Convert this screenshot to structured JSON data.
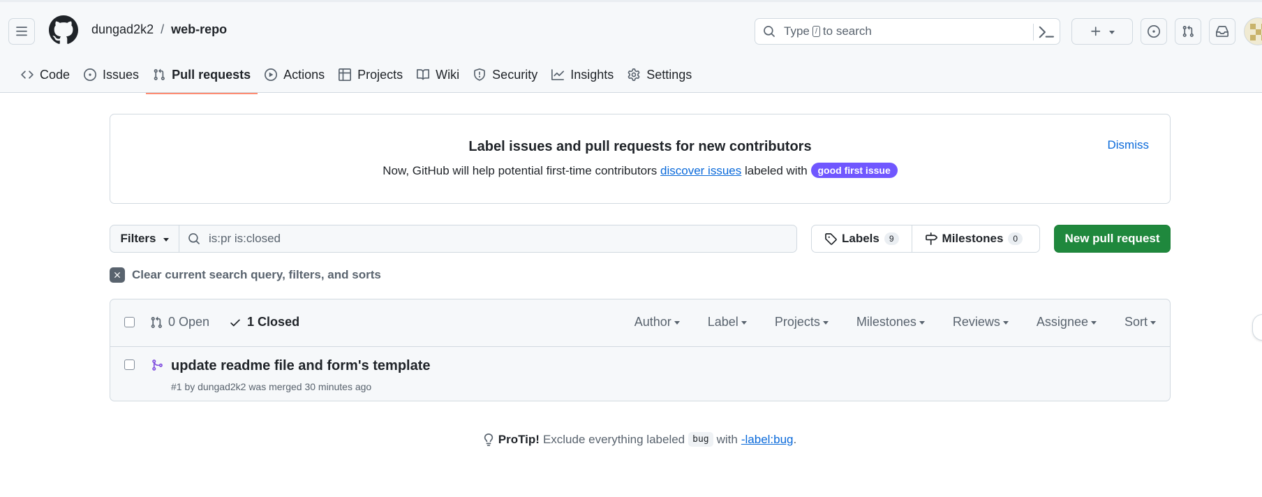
{
  "header": {
    "owner": "dungad2k2",
    "separator": "/",
    "repo": "web-repo",
    "search_prefix": "Type",
    "search_key": "/",
    "search_suffix": "to search"
  },
  "tabs": [
    {
      "label": "Code",
      "icon": "code-icon"
    },
    {
      "label": "Issues",
      "icon": "issue-icon"
    },
    {
      "label": "Pull requests",
      "icon": "pull-request-icon",
      "active": true
    },
    {
      "label": "Actions",
      "icon": "play-icon"
    },
    {
      "label": "Projects",
      "icon": "table-icon"
    },
    {
      "label": "Wiki",
      "icon": "book-icon"
    },
    {
      "label": "Security",
      "icon": "shield-icon"
    },
    {
      "label": "Insights",
      "icon": "graph-icon"
    },
    {
      "label": "Settings",
      "icon": "gear-icon"
    }
  ],
  "banner": {
    "title": "Label issues and pull requests for new contributors",
    "text_before": "Now, GitHub will help potential first-time contributors",
    "link": "discover issues",
    "text_after": "labeled with",
    "label": "good first issue",
    "label_color": "#7057ff",
    "dismiss": "Dismiss"
  },
  "filters": {
    "button": "Filters",
    "query": "is:pr is:closed",
    "labels": "Labels",
    "labels_count": "9",
    "milestones": "Milestones",
    "milestones_count": "0",
    "new_pr": "New pull request",
    "clear": "Clear current search query, filters, and sorts"
  },
  "list": {
    "open": "0 Open",
    "closed": "1 Closed",
    "sorts": [
      "Author",
      "Label",
      "Projects",
      "Milestones",
      "Reviews",
      "Assignee",
      "Sort"
    ],
    "items": [
      {
        "title": "update readme file and form's template",
        "meta": "#1 by dungad2k2 was merged 30 minutes ago"
      }
    ]
  },
  "protip": {
    "lead": "ProTip!",
    "text": "Exclude everything labeled",
    "code": "bug",
    "with": "with",
    "link": "-label:bug",
    "end": "."
  },
  "colors": {
    "accent_tab": "#fd8c73",
    "primary_button": "#1f883d",
    "link": "#0969da",
    "merged_icon": "#8250df"
  }
}
